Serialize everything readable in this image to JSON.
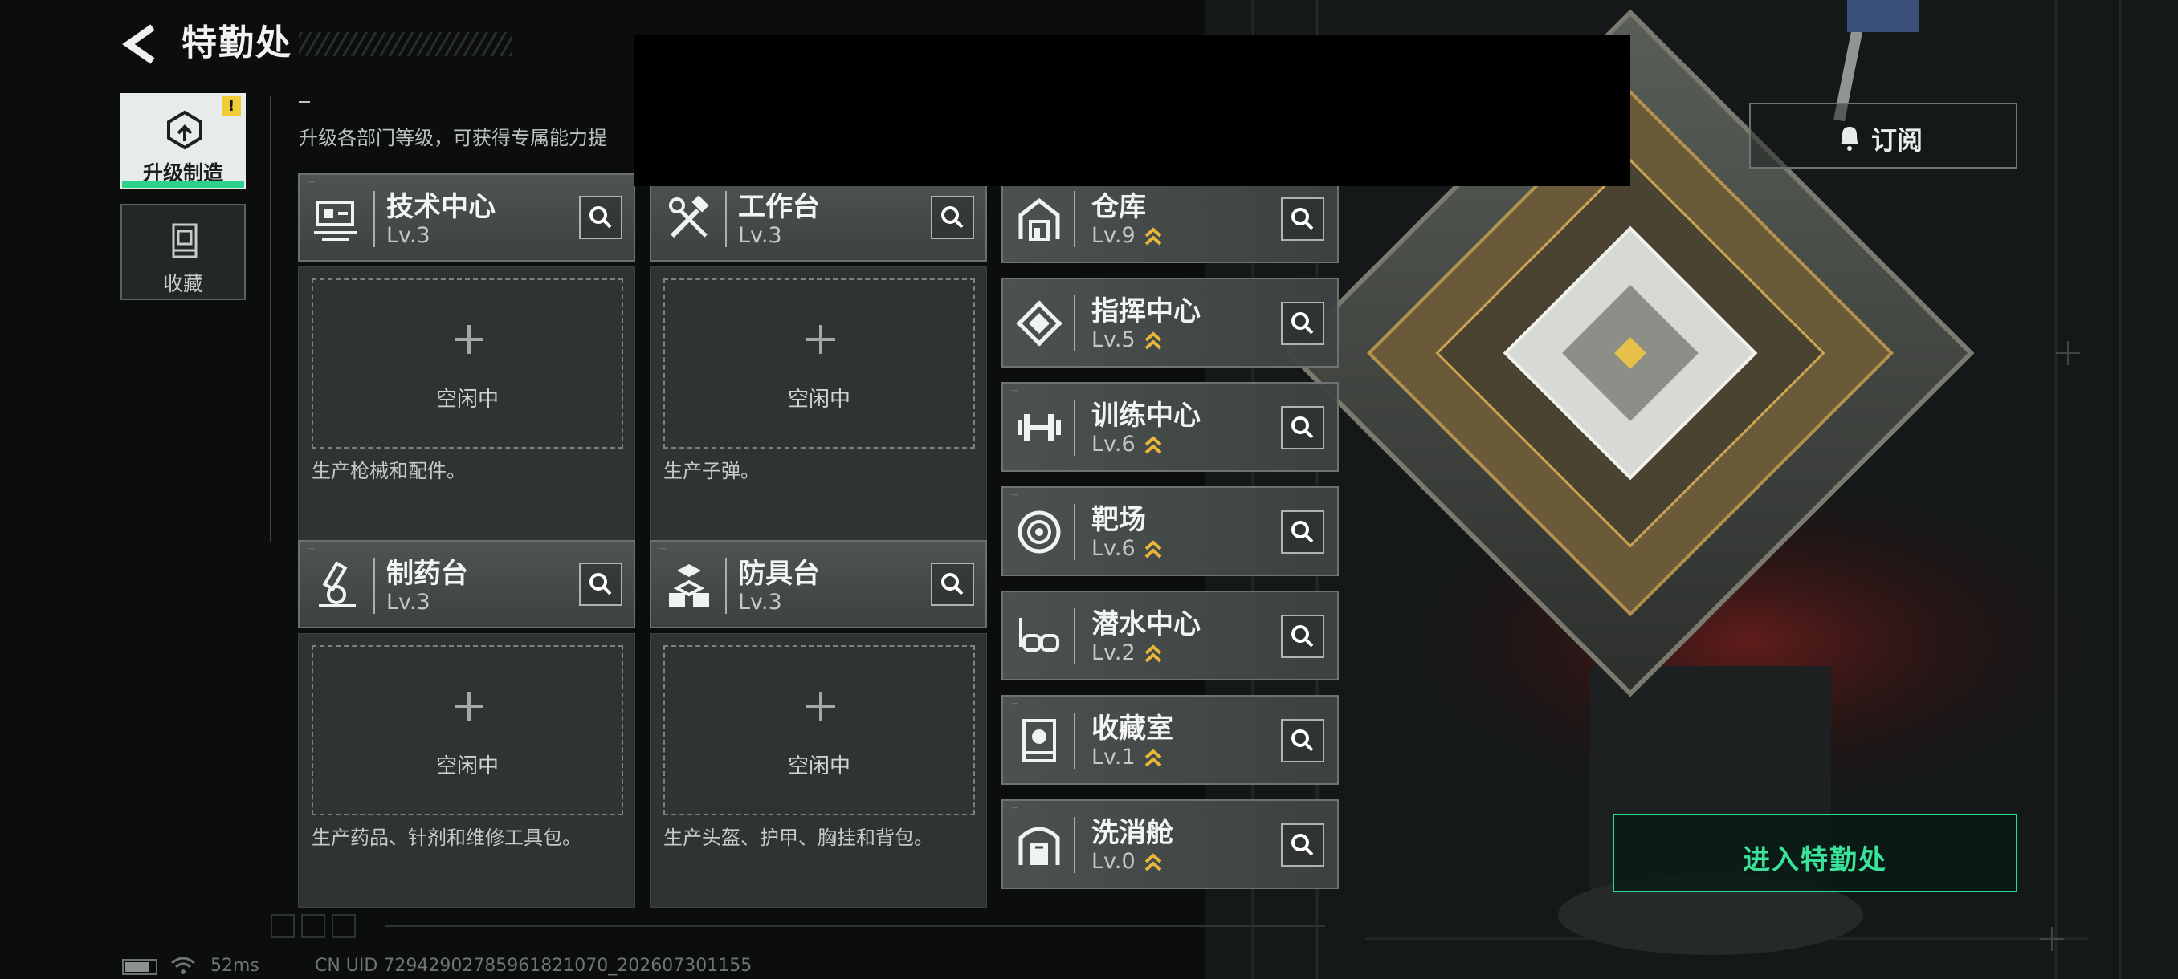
{
  "header": {
    "title": "特勤处"
  },
  "categories": [
    {
      "label": "升级制造",
      "active": true,
      "badge": "!"
    },
    {
      "label": "收藏",
      "active": false
    }
  ],
  "description": "升级各部门等级，可获得专属能力提",
  "workshops": [
    {
      "name": "技术中心",
      "level": "Lv.3",
      "icon": "tech-center-icon",
      "slot_status": "空闲中",
      "desc": "生产枪械和配件。"
    },
    {
      "name": "工作台",
      "level": "Lv.3",
      "icon": "workbench-icon",
      "slot_status": "空闲中",
      "desc": "生产子弹。"
    },
    {
      "name": "制药台",
      "level": "Lv.3",
      "icon": "pharmacy-icon",
      "slot_status": "空闲中",
      "desc": "生产药品、针剂和维修工具包。"
    },
    {
      "name": "防具台",
      "level": "Lv.3",
      "icon": "armor-bench-icon",
      "slot_status": "空闲中",
      "desc": "生产头盔、护甲、胸挂和背包。"
    }
  ],
  "departments": [
    {
      "name": "仓库",
      "level": "Lv.9",
      "icon": "warehouse-icon",
      "upgradable": true
    },
    {
      "name": "指挥中心",
      "level": "Lv.5",
      "icon": "command-center-icon",
      "upgradable": true
    },
    {
      "name": "训练中心",
      "level": "Lv.6",
      "icon": "training-center-icon",
      "upgradable": true
    },
    {
      "name": "靶场",
      "level": "Lv.6",
      "icon": "shooting-range-icon",
      "upgradable": true
    },
    {
      "name": "潜水中心",
      "level": "Lv.2",
      "icon": "diving-center-icon",
      "upgradable": true
    },
    {
      "name": "收藏室",
      "level": "Lv.1",
      "icon": "collection-room-icon",
      "upgradable": true
    },
    {
      "name": "洗消舱",
      "level": "Lv.0",
      "icon": "decon-chamber-icon",
      "upgradable": true
    }
  ],
  "subscribe": {
    "label": "订阅",
    "icon": "bell-icon"
  },
  "enter_button": {
    "label": "进入特勤处"
  },
  "status_bar": {
    "battery_level": 0.8,
    "ping": "52ms",
    "uid": "CN UID 7294290278596182107​0_20260730​1155"
  },
  "colors": {
    "accent_green": "#2ed88f",
    "upgrade_gold": "#e9b63a",
    "alert_yellow": "#f0cc37",
    "panel_gray": "#4a504f"
  }
}
